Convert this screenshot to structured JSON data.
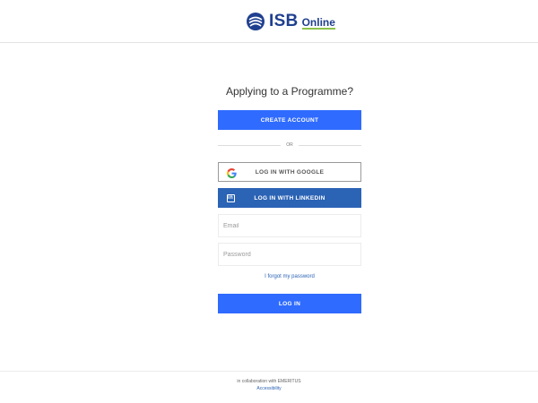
{
  "header": {
    "logo_main": "ISB",
    "logo_sub": "Online"
  },
  "form": {
    "heading": "Applying to a Programme?",
    "create_account_label": "CREATE ACCOUNT",
    "divider_label": "OR",
    "google_label": "LOG IN WITH GOOGLE",
    "linkedin_label": "LOG IN WITH LINKEDIN",
    "email": {
      "value": "",
      "placeholder": "Email"
    },
    "password": {
      "value": "",
      "placeholder": "Password"
    },
    "forgot_label": "I forgot my password",
    "login_label": "LOG IN"
  },
  "footer": {
    "collab_text": "in collaboration with EMERITUS",
    "accessibility_label": "Accessibility"
  },
  "colors": {
    "primary_button": "#2f6bff",
    "linkedin": "#2b63b5",
    "logo_blue": "#1f3f8f",
    "logo_accent": "#8bc34a"
  },
  "icons": {
    "google": "google-icon",
    "linkedin": "linkedin-icon",
    "logo": "isb-logo-icon"
  }
}
